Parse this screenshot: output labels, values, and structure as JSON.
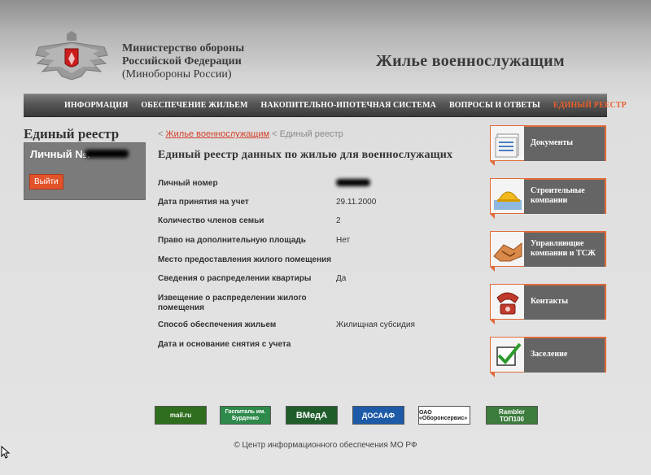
{
  "header": {
    "ministry_line1": "Министерство обороны",
    "ministry_line2": "Российской Федерации",
    "ministry_line3": "(Минобороны России)",
    "site_title": "Жилье военнослужащим"
  },
  "nav": {
    "items": [
      {
        "label": "ИНФОРМАЦИЯ"
      },
      {
        "label": "ОБЕСПЕЧЕНИЕ ЖИЛЬЕМ"
      },
      {
        "label": "НАКОПИТЕЛЬНО-ИПОТЕЧНАЯ СИСТЕМА"
      },
      {
        "label": "ВОПРОСЫ И ОТВЕТЫ"
      },
      {
        "label": "ЕДИНЫЙ РЕЕСТР",
        "active": true
      }
    ]
  },
  "left_panel": {
    "title": "Единый реестр",
    "personal_label": "Личный №:",
    "logout_label": "Выйти"
  },
  "breadcrumb": {
    "link": "Жилье военнослужащим",
    "current": "Единый реестр"
  },
  "main": {
    "title": "Единый реестр данных по жилью для военнослужащих",
    "rows": [
      {
        "label": "Личный номер",
        "value": ""
      },
      {
        "label": "Дата принятия на учет",
        "value": "29.11.2000"
      },
      {
        "label": "Количество членов семьи",
        "value": "2"
      },
      {
        "label": "Право на дополнительную площадь",
        "value": "Нет"
      },
      {
        "label": "Место предоставления жилого помещения",
        "value": ""
      },
      {
        "label": "Сведения о распределении квартиры",
        "value": "Да"
      },
      {
        "label": "Извещение о распределении жилого помещения",
        "value": ""
      },
      {
        "label": "Способ обеспечения жильем",
        "value": "Жилищная субсидия"
      },
      {
        "label": "Дата и основание снятия с учета",
        "value": ""
      }
    ]
  },
  "sidebar_boxes": [
    {
      "label": "Документы",
      "icon": "documents-icon"
    },
    {
      "label": "Строительные компании",
      "icon": "construction-helmet-icon"
    },
    {
      "label": "Управляющие компании и ТСЖ",
      "icon": "handshake-icon"
    },
    {
      "label": "Контакты",
      "icon": "phone-icon"
    },
    {
      "label": "Заселение",
      "icon": "checkmark-icon"
    }
  ],
  "footer": {
    "badges": [
      {
        "text": "mail.ru",
        "color": "#2e6e1e"
      },
      {
        "text": "Госпиталь им. Бурденко",
        "color": "#2d8a4a"
      },
      {
        "text": "ВМедА",
        "color": "#1f5d2a"
      },
      {
        "text": "ДОСААФ",
        "color": "#1d5aa8"
      },
      {
        "text": "ОАО «Оборонсервис»",
        "color": "#ffffff"
      },
      {
        "text": "Rambler ТОП100",
        "color": "#3c7c3c"
      }
    ],
    "copyright": "© Центр информационного обеспечения МО РФ"
  },
  "colors": {
    "accent": "#e06a3a",
    "nav_active": "#e8602c",
    "panel_gray": "#7b7b7b",
    "box_gray": "#656565"
  }
}
